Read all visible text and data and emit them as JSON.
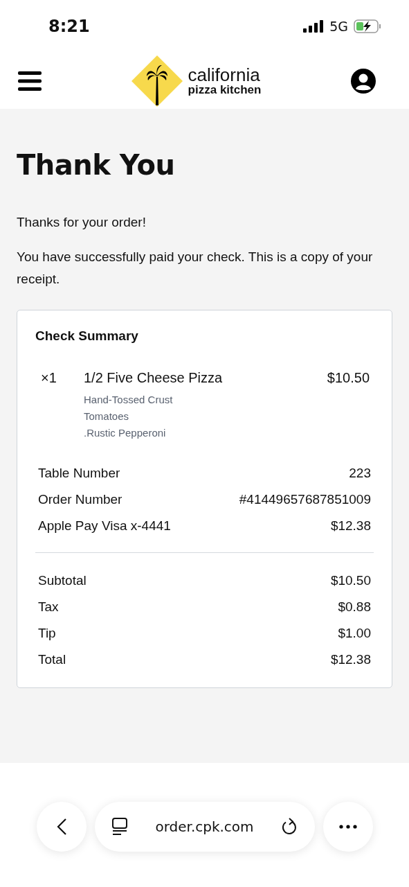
{
  "status_bar": {
    "time": "8:21",
    "network": "5G"
  },
  "header": {
    "logo": {
      "line_1": "california",
      "line_2": "pizza kitchen"
    }
  },
  "page": {
    "title": "Thank You",
    "paragraphs": [
      "Thanks for your order!",
      "You have successfully paid your check. This is a copy of your receipt."
    ]
  },
  "check_summary": {
    "title": "Check Summary",
    "items": [
      {
        "quantity": "×1",
        "name": "1/2 Five Cheese Pizza",
        "price": "$10.50",
        "modifiers": [
          "Hand-Tossed Crust",
          "Tomatoes",
          ".Rustic Pepperoni"
        ]
      }
    ],
    "details": [
      {
        "label": "Table Number",
        "value": "223"
      },
      {
        "label": "Order Number",
        "value": "#41449657687851009"
      },
      {
        "label": "Apple Pay Visa x-4441",
        "value": "$12.38"
      }
    ],
    "totals": [
      {
        "label": "Subtotal",
        "value": "$10.50"
      },
      {
        "label": "Tax",
        "value": "$0.88"
      },
      {
        "label": "Tip",
        "value": "$1.00"
      },
      {
        "label": "Total",
        "value": "$12.38"
      }
    ]
  },
  "browser_bar": {
    "url": "order.cpk.com"
  }
}
